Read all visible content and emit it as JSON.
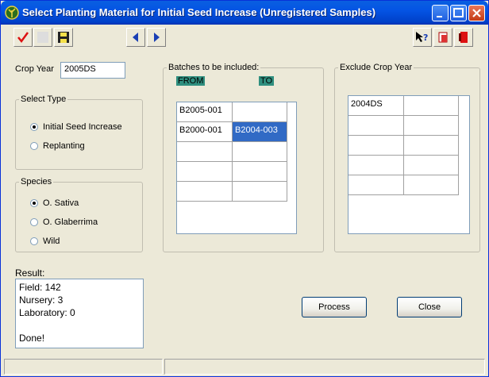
{
  "window": {
    "title": "Select Planting Material for Initial Seed Increase (Unregistered Samples)"
  },
  "toolbar": {
    "icons": [
      "check-icon",
      "blank-icon",
      "save-icon",
      "prev-icon",
      "next-icon",
      "help-icon",
      "print-icon",
      "exit-icon"
    ]
  },
  "crop_year": {
    "label": "Crop Year",
    "value": "2005DS"
  },
  "select_type": {
    "title": "Select Type",
    "options": [
      {
        "label": "Initial Seed Increase",
        "selected": true
      },
      {
        "label": "Replanting",
        "selected": false
      }
    ]
  },
  "species": {
    "title": "Species",
    "options": [
      {
        "label": "O. Sativa",
        "selected": true
      },
      {
        "label": "O. Glaberrima",
        "selected": false
      },
      {
        "label": "Wild",
        "selected": false
      }
    ]
  },
  "batches": {
    "title": "Batches to be included:",
    "from_label": "FROM",
    "to_label": "TO",
    "rows": [
      [
        "B2005-001",
        ""
      ],
      [
        "B2000-001",
        "B2004-003"
      ],
      [
        "",
        ""
      ],
      [
        "",
        ""
      ],
      [
        "",
        ""
      ]
    ]
  },
  "exclude": {
    "title": "Exclude Crop Year",
    "rows": [
      [
        "2004DS",
        ""
      ],
      [
        "",
        ""
      ],
      [
        "",
        ""
      ],
      [
        "",
        ""
      ],
      [
        "",
        ""
      ]
    ]
  },
  "result": {
    "label": "Result:",
    "lines": [
      "Field: 142",
      "Nursery: 3",
      "Laboratory: 0",
      "",
      "Done!"
    ]
  },
  "buttons": {
    "process": "Process",
    "close": "Close"
  },
  "colors": {
    "titlebar": "#0454e4",
    "selection": "#316ac5",
    "header_tag": "#2f8f7f"
  }
}
